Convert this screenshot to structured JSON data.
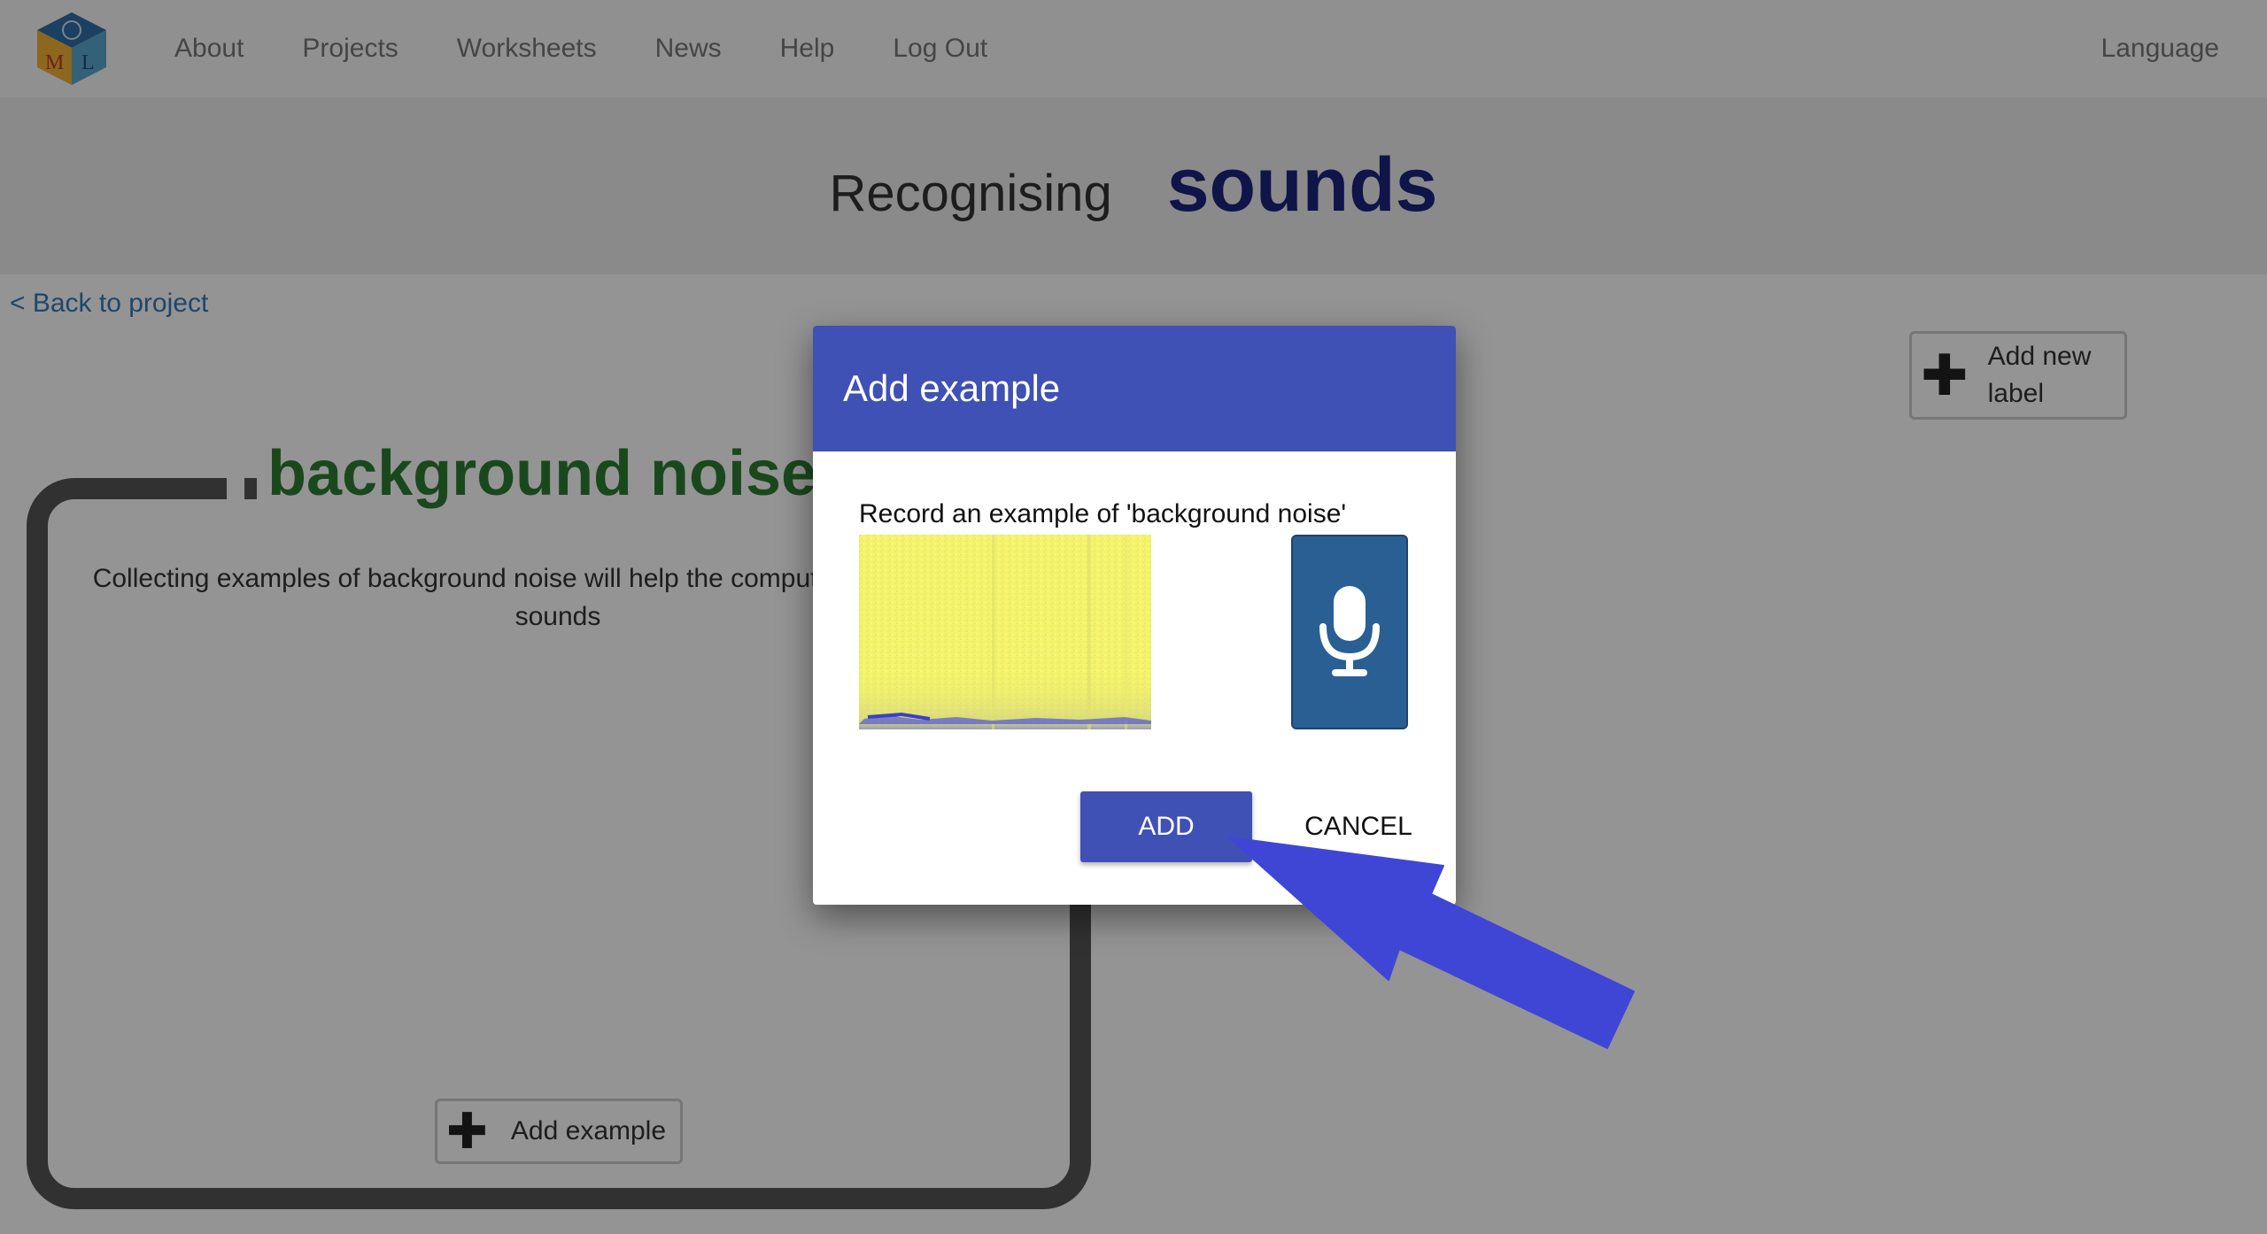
{
  "nav": {
    "links": [
      "About",
      "Projects",
      "Worksheets",
      "News",
      "Help",
      "Log Out"
    ],
    "language": "Language",
    "logo_letters": [
      "M",
      "L"
    ]
  },
  "header": {
    "prefix": "Recognising",
    "title": "sounds"
  },
  "back_link": "< Back to project",
  "add_label_button": "Add new label",
  "label_panel": {
    "name": "background noise",
    "description": "Collecting examples of background noise will help the computer recognize your sounds",
    "add_example_button": "Add example"
  },
  "dialog": {
    "title": "Add example",
    "prompt": "Record an example of 'background noise'",
    "add_button": "ADD",
    "cancel_button": "CANCEL"
  },
  "colors": {
    "dialog_header": "#3f51b5",
    "title_main": "#1a237e",
    "label_title": "#2e7d32",
    "mic_button": "#2a5f94",
    "arrow": "#3f46d6",
    "spectrogram": "#f4f36b"
  },
  "icons": [
    "logo-cube-icon",
    "plus-icon",
    "microphone-icon",
    "pointer-arrow-icon"
  ]
}
